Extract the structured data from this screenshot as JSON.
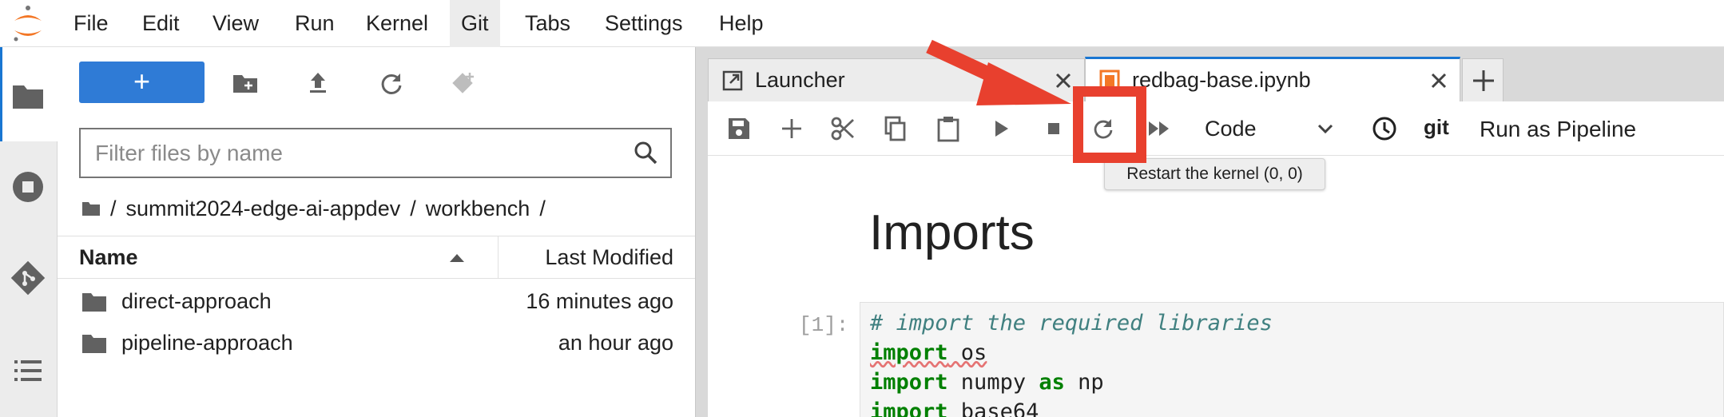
{
  "menubar": {
    "items": [
      "File",
      "Edit",
      "View",
      "Run",
      "Kernel",
      "Git",
      "Tabs",
      "Settings",
      "Help"
    ],
    "active": "Git"
  },
  "filebrowser": {
    "new_label": "+",
    "filter_placeholder": "Filter files by name",
    "breadcrumb": [
      "summit2024-edge-ai-appdev",
      "workbench"
    ],
    "column_name": "Name",
    "column_modified": "Last Modified",
    "files": [
      {
        "name": "direct-approach",
        "modified": "16 minutes ago",
        "type": "folder"
      },
      {
        "name": "pipeline-approach",
        "modified": "an hour ago",
        "type": "folder"
      }
    ]
  },
  "tabs": [
    {
      "label": "Launcher",
      "icon": "launcher-icon",
      "active": false
    },
    {
      "label": "redbag-base.ipynb",
      "icon": "notebook-icon",
      "active": true
    }
  ],
  "toolbar": {
    "cell_type": "Code",
    "git_label": "git",
    "pipeline_label": "Run as Pipeline",
    "tooltip": "Restart the kernel (0, 0)"
  },
  "notebook": {
    "heading": "Imports",
    "prompt": "[1]:",
    "code": {
      "comment": "# import the required libraries",
      "kw_import": "import",
      "kw_as": "as",
      "line1_mod": " os",
      "line2_mod": " numpy ",
      "line2_alias": " np",
      "line3_mod": " base64"
    }
  },
  "colors": {
    "accent": "#1976d2",
    "new_button": "#2f7bd6",
    "annotation": "#e8402e",
    "notebook_icon": "#f37726"
  }
}
